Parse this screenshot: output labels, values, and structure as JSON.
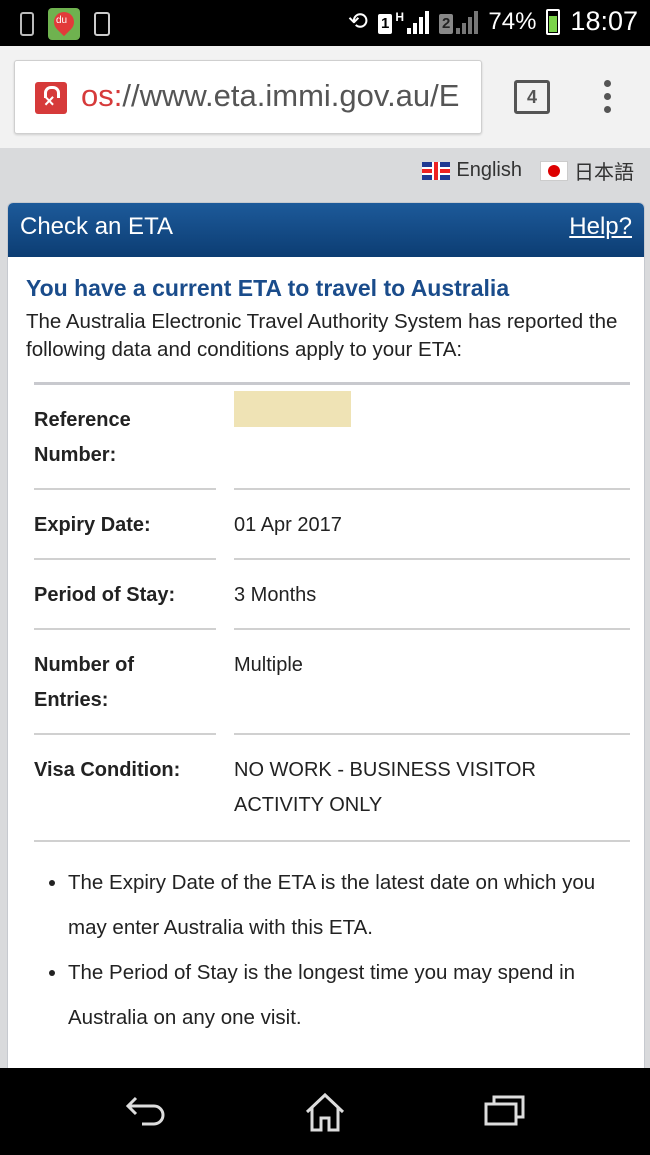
{
  "status_bar": {
    "sim1": "1",
    "sim1_network": "H",
    "sim2": "2",
    "battery": "74%",
    "time": "18:07",
    "icons": [
      "phone-icon",
      "du-map-icon",
      "device-icon",
      "rotate-icon",
      "signal-icon",
      "battery-icon"
    ]
  },
  "browser": {
    "url_scheme": "os:",
    "url_rest": "//www.eta.immi.gov.au/E",
    "tab_count": "4"
  },
  "languages": [
    {
      "label": "English",
      "icon": "uk-flag-icon"
    },
    {
      "label": "日本語",
      "icon": "japan-flag-icon"
    }
  ],
  "panel": {
    "title": "Check an ETA",
    "help": "Help?"
  },
  "content": {
    "heading": "You have a current ETA to travel to Australia",
    "intro": "The Australia Electronic Travel Authority System has reported the following data and conditions apply to your ETA:"
  },
  "details": [
    {
      "label": "Reference Number:",
      "value": ""
    },
    {
      "label": "Expiry Date:",
      "value": "01 Apr 2017"
    },
    {
      "label": "Period of Stay:",
      "value": "3 Months"
    },
    {
      "label": "Number of Entries:",
      "value": "Multiple"
    },
    {
      "label": "Visa Condition:",
      "value": "NO WORK - BUSINESS VISITOR ACTIVITY ONLY"
    }
  ],
  "notes": [
    "The Expiry Date of the ETA is the latest date on which you may enter Australia with this ETA.",
    "The Period of Stay is the longest time you may spend in Australia on any one visit."
  ],
  "nav": {
    "icons": [
      "back-icon",
      "home-icon",
      "recent-apps-icon"
    ]
  },
  "colors": {
    "header_bg": "#0c3d73",
    "heading_text": "#1a4c8b",
    "lock_red": "#d63a3a",
    "redaction": "#efe3b5"
  }
}
